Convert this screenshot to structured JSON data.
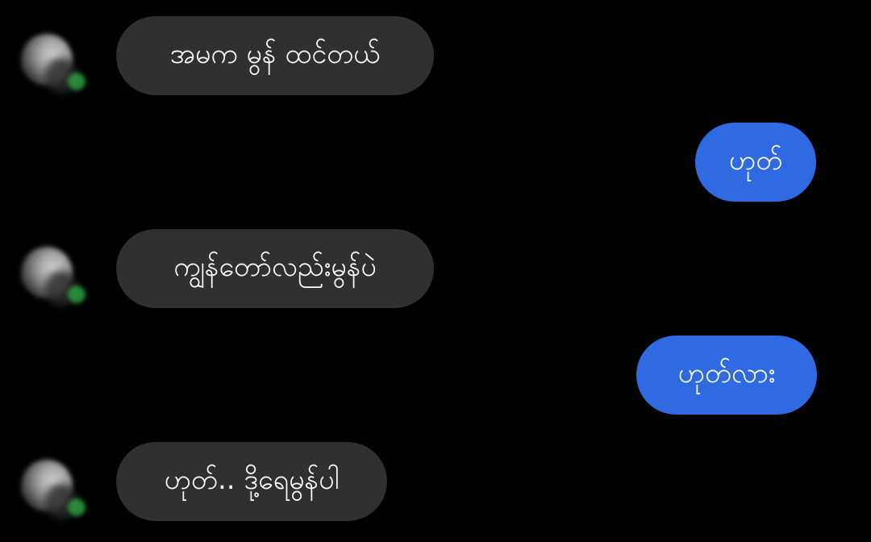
{
  "messages": [
    {
      "direction": "incoming",
      "text": "အမက မွန် ထင်တယ်"
    },
    {
      "direction": "outgoing",
      "text": "ဟုတ်"
    },
    {
      "direction": "incoming",
      "text": "ကျွန်တော်လည်းမွန်ပဲ"
    },
    {
      "direction": "outgoing",
      "text": "ဟုတ်လား"
    },
    {
      "direction": "incoming",
      "text": "ဟုတ်.. ဒို့ရေမွန်ပါ"
    }
  ],
  "colors": {
    "background": "#000000",
    "incoming_bubble": "#303030",
    "outgoing_bubble": "#2f6ae3",
    "presence": "#2ea043",
    "text": "#ffffff"
  }
}
